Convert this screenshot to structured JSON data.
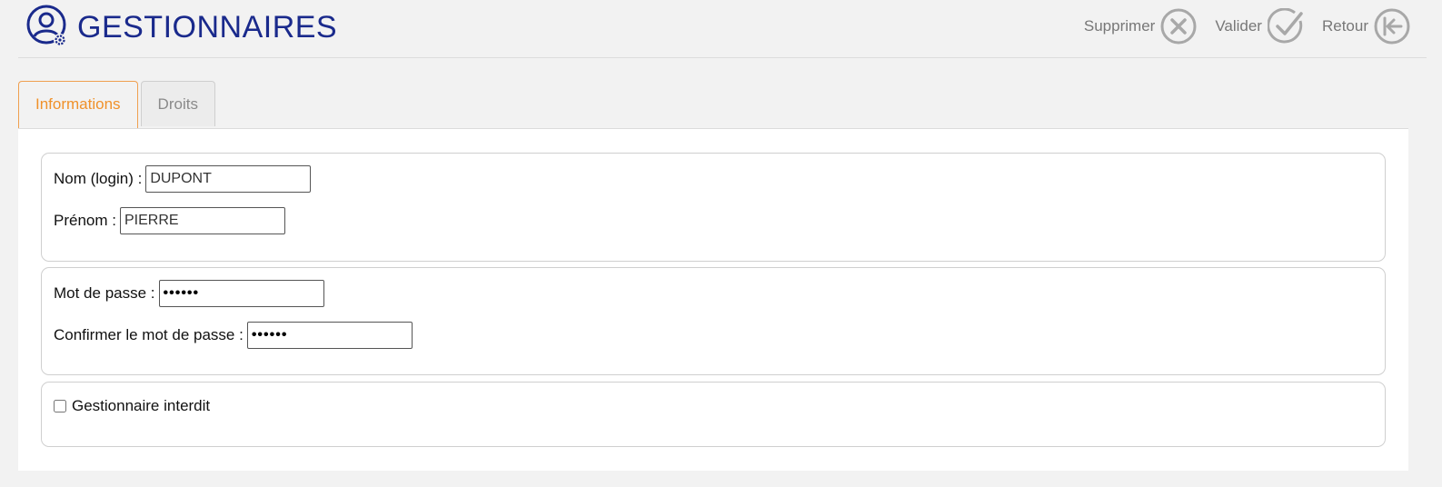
{
  "header": {
    "title": "GESTIONNAIRES",
    "icon": "user-gear-icon",
    "accent_color": "#1a2a8c"
  },
  "actions": {
    "delete_label": "Supprimer",
    "validate_label": "Valider",
    "back_label": "Retour"
  },
  "tabs": [
    {
      "label": "Informations",
      "active": true
    },
    {
      "label": "Droits",
      "active": false
    }
  ],
  "identity": {
    "login_label": "Nom (login) :",
    "login_value": "DUPONT",
    "firstname_label": "Prénom :",
    "firstname_value": "PIERRE"
  },
  "password": {
    "password_label": "Mot de passe :",
    "password_value": "••••••",
    "confirm_label": "Confirmer le mot de passe :",
    "confirm_value": "••••••"
  },
  "status": {
    "forbidden_label": "Gestionnaire interdit",
    "forbidden_checked": false
  },
  "colors": {
    "tab_active": "#f0912a",
    "icon_gray": "#9a9a9a"
  }
}
